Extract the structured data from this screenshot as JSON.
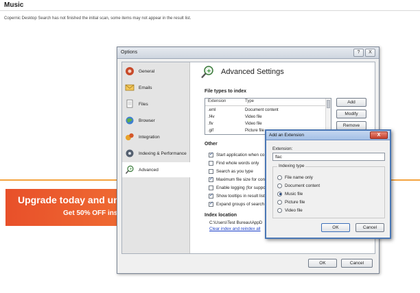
{
  "page": {
    "title": "Music",
    "notice": "Copernic Desktop Search has not finished the initial scan, some items may not appear in the result list."
  },
  "banner": {
    "line1": "Upgrade today and unl",
    "line2": "Get 50% OFF inst"
  },
  "options_window": {
    "title": "Options",
    "help_label": "?",
    "close_label": "X",
    "sidebar": {
      "items": [
        {
          "label": "General",
          "icon": "general-icon"
        },
        {
          "label": "Emails",
          "icon": "email-icon"
        },
        {
          "label": "Files",
          "icon": "files-icon"
        },
        {
          "label": "Browser",
          "icon": "browser-icon"
        },
        {
          "label": "Integration",
          "icon": "integration-icon"
        },
        {
          "label": "Indexing & Performance",
          "icon": "performance-icon"
        },
        {
          "label": "Advanced",
          "icon": "advanced-icon",
          "selected": true
        }
      ]
    },
    "heading": "Advanced Settings",
    "file_types": {
      "label": "File types to index",
      "columns": [
        "Extension",
        "Type"
      ],
      "rows": [
        {
          "ext": ".eml",
          "type": "Document content"
        },
        {
          "ext": ".f4v",
          "type": "Video file"
        },
        {
          "ext": ".flv",
          "type": "Video file"
        },
        {
          "ext": ".gif",
          "type": "Picture file"
        }
      ],
      "add_label": "Add",
      "modify_label": "Modify",
      "remove_label": "Remove"
    },
    "other": {
      "label": "Other",
      "options": [
        {
          "label": "Start application when co",
          "checked": true
        },
        {
          "label": "Find whole words only",
          "checked": false
        },
        {
          "label": "Search as you type",
          "checked": false
        },
        {
          "label": "Maximum file size for con",
          "checked": true
        },
        {
          "label": "Enable logging (for suppo",
          "checked": false
        },
        {
          "label": "Show tooltips in result list",
          "checked": true
        },
        {
          "label": "Expand groups of search",
          "checked": true
        }
      ]
    },
    "index_location": {
      "label": "Index location",
      "path": "C:\\Users\\Test Bureau\\AppD",
      "link": "Clear index and reindex all"
    },
    "ok_label": "OK",
    "cancel_label": "Cancel"
  },
  "add_extension_dialog": {
    "title": "Add an Extension",
    "close_label": "X",
    "extension_label": "Extension:",
    "extension_value": "flac",
    "indexing_type_label": "Indexing type",
    "options": [
      {
        "label": "File name only",
        "selected": false
      },
      {
        "label": "Document content",
        "selected": false
      },
      {
        "label": "Music file",
        "selected": true
      },
      {
        "label": "Picture file",
        "selected": false
      },
      {
        "label": "Video file",
        "selected": false
      }
    ],
    "ok_label": "OK",
    "cancel_label": "Cancel"
  },
  "colors": {
    "accent_orange": "#f4a340",
    "banner": "#e8502a",
    "dialog_border": "#4a77b5",
    "link": "#1a3ec8"
  }
}
